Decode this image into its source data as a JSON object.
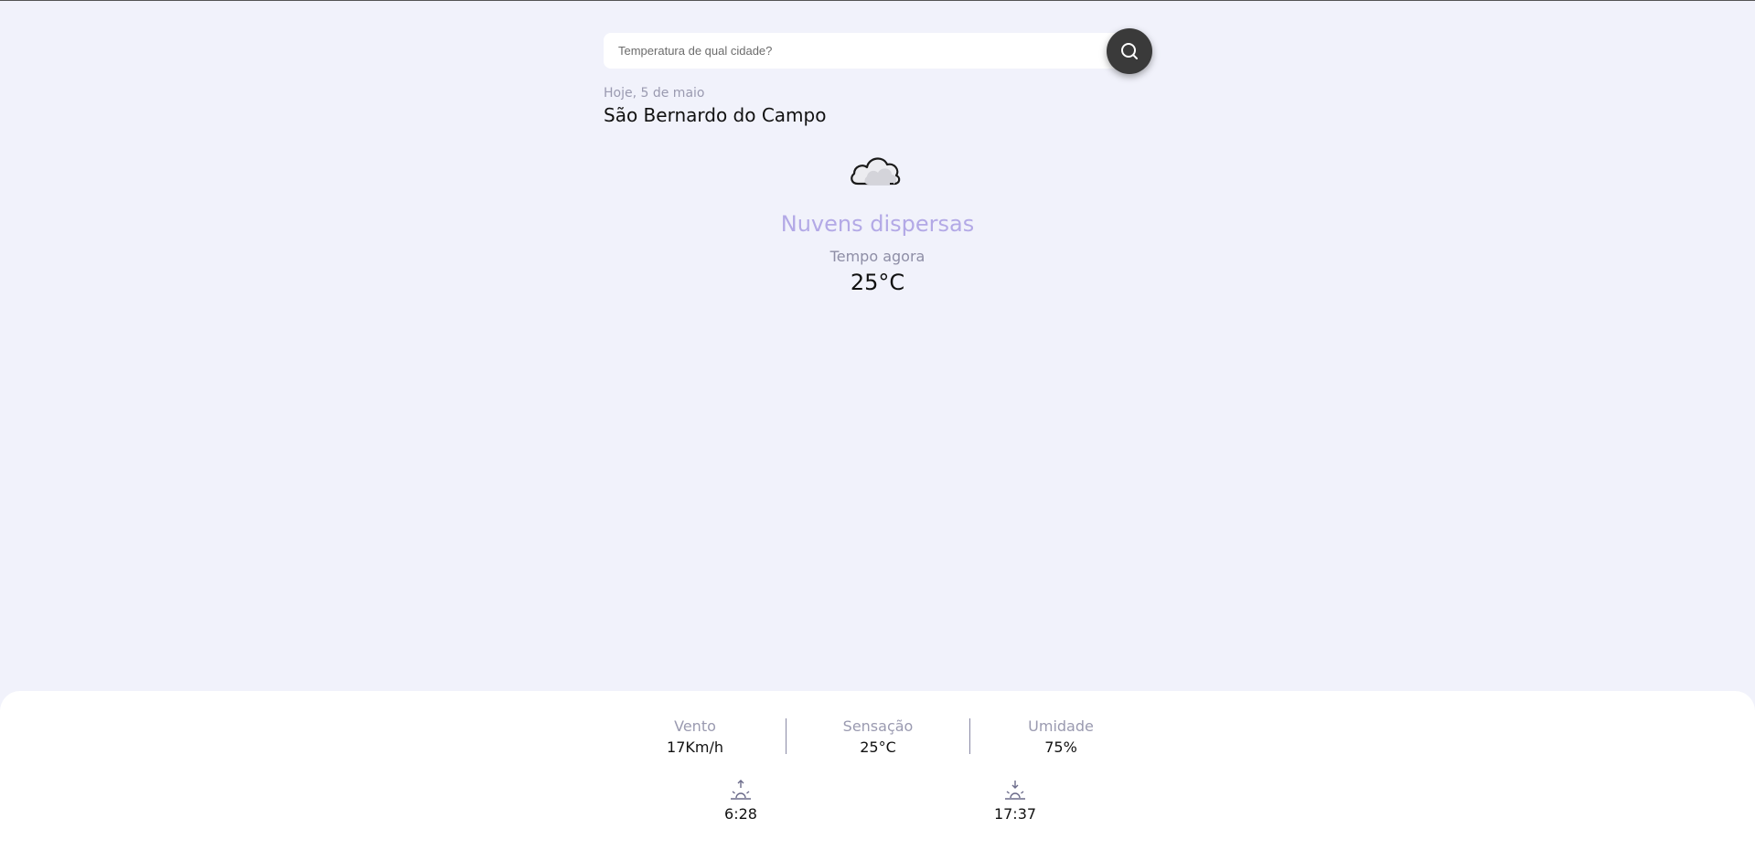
{
  "search": {
    "placeholder": "Temperatura de qual cidade?",
    "value": "",
    "icon": "search-icon"
  },
  "location": {
    "date": "Hoje, 5 de maio",
    "city": "São Bernardo do Campo"
  },
  "current": {
    "icon": "cloud-icon",
    "condition": "Nuvens dispersas",
    "now_label": "Tempo agora",
    "temperature": "25°C"
  },
  "stats": [
    {
      "label": "Vento",
      "value": "17Km/h"
    },
    {
      "label": "Sensação",
      "value": "25°C"
    },
    {
      "label": "Umidade",
      "value": "75%"
    }
  ],
  "sun": {
    "sunrise": {
      "icon": "sunrise-icon",
      "time": "6:28"
    },
    "sunset": {
      "icon": "sunset-icon",
      "time": "17:37"
    }
  },
  "colors": {
    "background": "#f1f2fb",
    "accent": "#b3a9e6",
    "muted": "#9a9ab0",
    "button": "#3a3a3a"
  }
}
